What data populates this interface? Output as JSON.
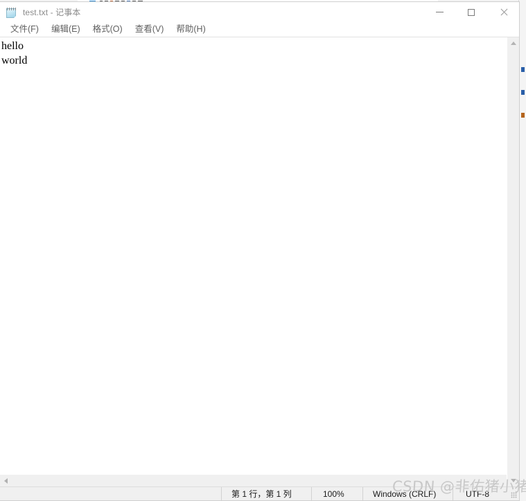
{
  "window": {
    "title": "test.txt - 记事本",
    "app_icon": "notepad-icon",
    "controls": {
      "minimize": "minimize-icon",
      "maximize": "maximize-icon",
      "close": "close-icon"
    }
  },
  "menu": {
    "items": [
      {
        "label": "文件(F)"
      },
      {
        "label": "编辑(E)"
      },
      {
        "label": "格式(O)"
      },
      {
        "label": "查看(V)"
      },
      {
        "label": "帮助(H)"
      }
    ]
  },
  "editor": {
    "content": "hello\nworld"
  },
  "scrollbars": {
    "vertical": {
      "up_arrow": "chevron-up-icon",
      "down_arrow": "chevron-down-icon"
    },
    "horizontal": {
      "left_arrow": "chevron-left-icon"
    }
  },
  "status_bar": {
    "position": "第 1 行，第 1 列",
    "zoom": "100%",
    "line_ending": "Windows (CRLF)",
    "encoding": "UTF-8"
  },
  "watermark": {
    "text": "CSDN @非佑猪小猪"
  },
  "colors": {
    "window_background": "#ffffff",
    "title_text": "#8a8a8a",
    "menu_text": "#606060",
    "status_bar_background": "#f0f0f0",
    "scrollbar_background": "#f0f0f0",
    "watermark": "#c8c8c8",
    "text": "#000000"
  }
}
